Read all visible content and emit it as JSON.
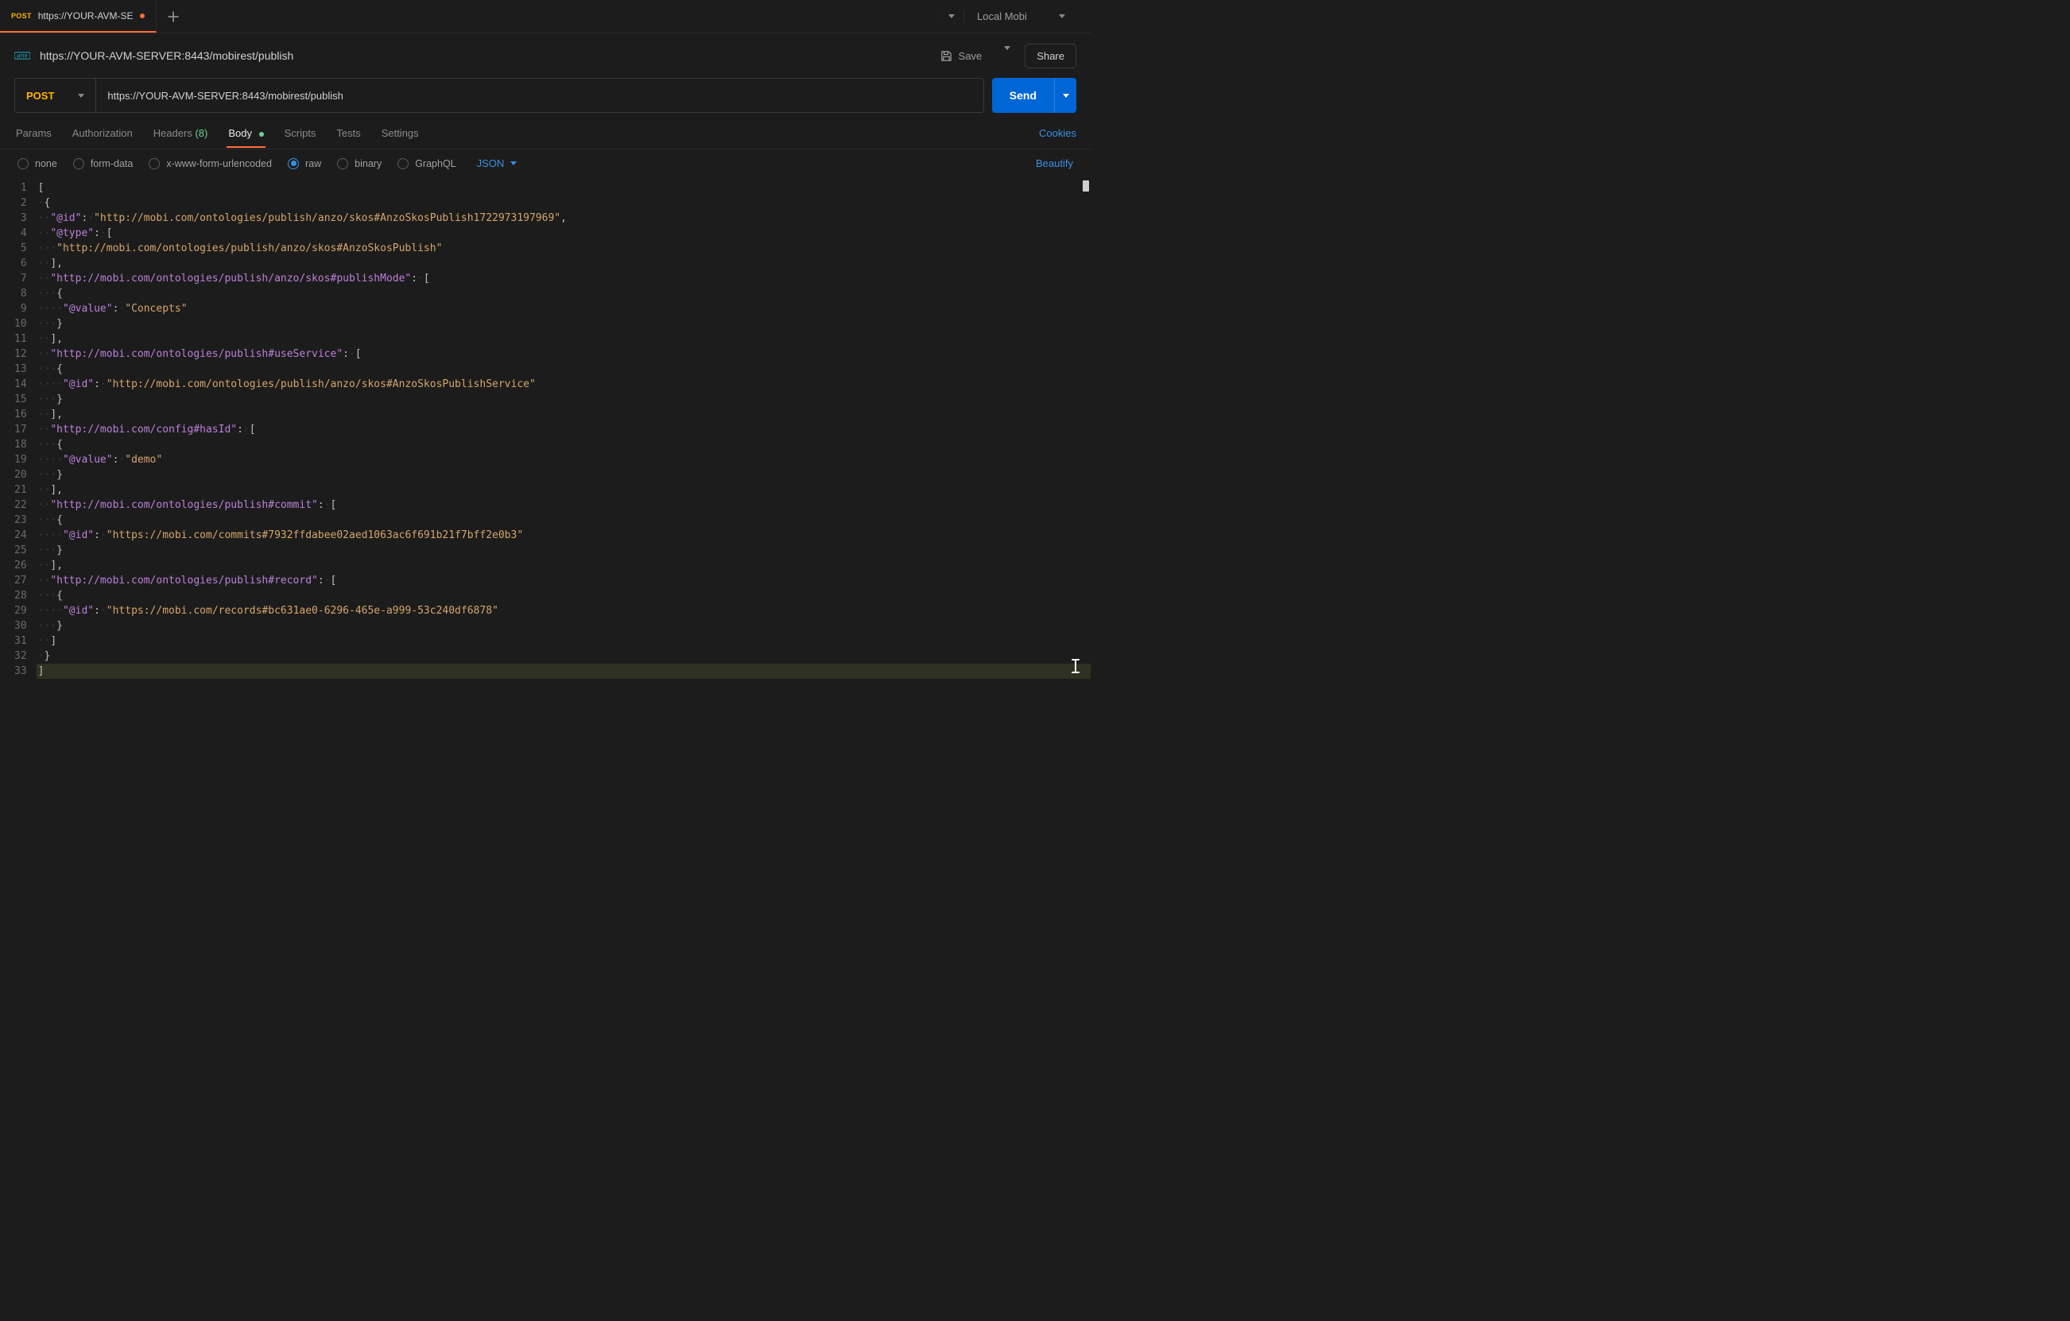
{
  "tabBar": {
    "tabs": [
      {
        "method": "POST",
        "title": "https://YOUR-AVM-SE",
        "dirty": true,
        "active": true
      }
    ],
    "environment": "Local Mobi"
  },
  "request": {
    "icon": "http-icon",
    "title": "https://YOUR-AVM-SERVER:8443/mobirest/publish",
    "saveLabel": "Save",
    "shareLabel": "Share",
    "method": "POST",
    "url": "https://YOUR-AVM-SERVER:8443/mobirest/publish",
    "sendLabel": "Send"
  },
  "sectionTabs": {
    "params": "Params",
    "authorization": "Authorization",
    "headers": "Headers",
    "headersCount": "(8)",
    "body": "Body",
    "scripts": "Scripts",
    "tests": "Tests",
    "settings": "Settings",
    "cookies": "Cookies"
  },
  "bodyTypes": {
    "none": "none",
    "formData": "form-data",
    "urlencoded": "x-www-form-urlencoded",
    "raw": "raw",
    "binary": "binary",
    "graphql": "GraphQL",
    "contentType": "JSON",
    "beautify": "Beautify"
  },
  "editor": {
    "lineCount": 33,
    "highlightLine": 33,
    "tokens": [
      [
        [
          "p",
          "["
        ]
      ],
      [
        [
          "ws",
          "·"
        ],
        [
          "p",
          "{"
        ]
      ],
      [
        [
          "ws",
          "··"
        ],
        [
          "k",
          "\"@id\""
        ],
        [
          "p",
          ":"
        ],
        [
          "ws",
          "·"
        ],
        [
          "s",
          "\"http://mobi.com/ontologies/publish/anzo/skos#AnzoSkosPublish1722973197969\""
        ],
        [
          "p",
          ","
        ]
      ],
      [
        [
          "ws",
          "··"
        ],
        [
          "k",
          "\"@type\""
        ],
        [
          "p",
          ":"
        ],
        [
          "ws",
          "·"
        ],
        [
          "p",
          "["
        ]
      ],
      [
        [
          "ws",
          "···"
        ],
        [
          "s",
          "\"http://mobi.com/ontologies/publish/anzo/skos#AnzoSkosPublish\""
        ]
      ],
      [
        [
          "ws",
          "··"
        ],
        [
          "p",
          "],"
        ]
      ],
      [
        [
          "ws",
          "··"
        ],
        [
          "k",
          "\"http://mobi.com/ontologies/publish/anzo/skos#publishMode\""
        ],
        [
          "p",
          ":"
        ],
        [
          "ws",
          "·"
        ],
        [
          "p",
          "["
        ]
      ],
      [
        [
          "ws",
          "···"
        ],
        [
          "p",
          "{"
        ]
      ],
      [
        [
          "ws",
          "····"
        ],
        [
          "k",
          "\"@value\""
        ],
        [
          "p",
          ":"
        ],
        [
          "ws",
          "·"
        ],
        [
          "s",
          "\"Concepts\""
        ]
      ],
      [
        [
          "ws",
          "···"
        ],
        [
          "p",
          "}"
        ]
      ],
      [
        [
          "ws",
          "··"
        ],
        [
          "p",
          "],"
        ]
      ],
      [
        [
          "ws",
          "··"
        ],
        [
          "k",
          "\"http://mobi.com/ontologies/publish#useService\""
        ],
        [
          "p",
          ":"
        ],
        [
          "ws",
          "·"
        ],
        [
          "p",
          "["
        ]
      ],
      [
        [
          "ws",
          "···"
        ],
        [
          "p",
          "{"
        ]
      ],
      [
        [
          "ws",
          "····"
        ],
        [
          "k",
          "\"@id\""
        ],
        [
          "p",
          ":"
        ],
        [
          "ws",
          "·"
        ],
        [
          "s",
          "\"http://mobi.com/ontologies/publish/anzo/skos#AnzoSkosPublishService\""
        ]
      ],
      [
        [
          "ws",
          "···"
        ],
        [
          "p",
          "}"
        ]
      ],
      [
        [
          "ws",
          "··"
        ],
        [
          "p",
          "],"
        ]
      ],
      [
        [
          "ws",
          "··"
        ],
        [
          "k",
          "\"http://mobi.com/config#hasId\""
        ],
        [
          "p",
          ":"
        ],
        [
          "ws",
          "·"
        ],
        [
          "p",
          "["
        ]
      ],
      [
        [
          "ws",
          "···"
        ],
        [
          "p",
          "{"
        ]
      ],
      [
        [
          "ws",
          "····"
        ],
        [
          "k",
          "\"@value\""
        ],
        [
          "p",
          ":"
        ],
        [
          "ws",
          "·"
        ],
        [
          "s",
          "\"demo\""
        ]
      ],
      [
        [
          "ws",
          "···"
        ],
        [
          "p",
          "}"
        ]
      ],
      [
        [
          "ws",
          "··"
        ],
        [
          "p",
          "],"
        ]
      ],
      [
        [
          "ws",
          "··"
        ],
        [
          "k",
          "\"http://mobi.com/ontologies/publish#commit\""
        ],
        [
          "p",
          ":"
        ],
        [
          "ws",
          "·"
        ],
        [
          "p",
          "["
        ]
      ],
      [
        [
          "ws",
          "···"
        ],
        [
          "p",
          "{"
        ]
      ],
      [
        [
          "ws",
          "····"
        ],
        [
          "k",
          "\"@id\""
        ],
        [
          "p",
          ":"
        ],
        [
          "ws",
          "·"
        ],
        [
          "s",
          "\"https://mobi.com/commits#7932ffdabee02aed1063ac6f691b21f7bff2e0b3\""
        ]
      ],
      [
        [
          "ws",
          "···"
        ],
        [
          "p",
          "}"
        ]
      ],
      [
        [
          "ws",
          "··"
        ],
        [
          "p",
          "],"
        ]
      ],
      [
        [
          "ws",
          "··"
        ],
        [
          "k",
          "\"http://mobi.com/ontologies/publish#record\""
        ],
        [
          "p",
          ":"
        ],
        [
          "ws",
          "·"
        ],
        [
          "p",
          "["
        ]
      ],
      [
        [
          "ws",
          "···"
        ],
        [
          "p",
          "{"
        ]
      ],
      [
        [
          "ws",
          "····"
        ],
        [
          "k",
          "\"@id\""
        ],
        [
          "p",
          ":"
        ],
        [
          "ws",
          "·"
        ],
        [
          "s",
          "\"https://mobi.com/records#bc631ae0-6296-465e-a999-53c240df6878\""
        ]
      ],
      [
        [
          "ws",
          "···"
        ],
        [
          "p",
          "}"
        ]
      ],
      [
        [
          "ws",
          "··"
        ],
        [
          "p",
          "]"
        ]
      ],
      [
        [
          "ws",
          "·"
        ],
        [
          "p",
          "}"
        ]
      ],
      [
        [
          "p",
          "]"
        ]
      ]
    ]
  }
}
